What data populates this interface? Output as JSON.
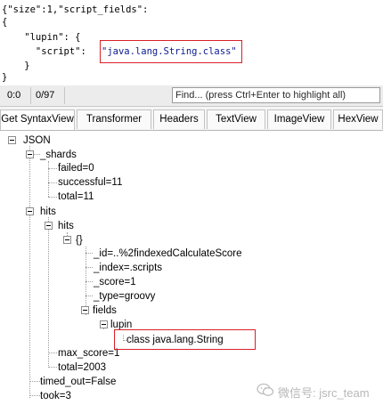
{
  "editor": {
    "lines": [
      "{\"size\":1,\"script_fields\":",
      "{",
      "    \"lupin\": {",
      "      \"script\": ",
      "    }",
      "}"
    ],
    "script_value": "\"java.lang.String.class\""
  },
  "status": {
    "position": "0:0",
    "count": "0/97",
    "find_placeholder": "Find... (press Ctrl+Enter to highlight all)"
  },
  "tabs": [
    {
      "label": "Get SyntaxView",
      "active": true
    },
    {
      "label": "Transformer",
      "active": false
    },
    {
      "label": "Headers",
      "active": false
    },
    {
      "label": "TextView",
      "active": false
    },
    {
      "label": "ImageView",
      "active": false
    },
    {
      "label": "HexView",
      "active": false
    }
  ],
  "tree": {
    "root": "JSON",
    "shards": "_shards",
    "failed": "failed=0",
    "successful": "successful=11",
    "total_shards": "total=11",
    "hits": "hits",
    "hits_inner": "hits",
    "braces": "{}",
    "id": "_id=..%2findexedCalculateScore",
    "index": "_index=.scripts",
    "score": "_score=1",
    "type": "_type=groovy",
    "fields": "fields",
    "lupin": "lupin",
    "class_value": "class java.lang.String",
    "max_score": "max_score=1",
    "total_hits": "total=2003",
    "timed_out": "timed_out=False",
    "took": "took=3"
  },
  "watermark": {
    "text": "微信号: jsrc_team",
    "icon": "wechat-icon"
  },
  "colors": {
    "highlight_border": "#d9202a",
    "string_color": "#0a1a8c",
    "tree_lines": "#9c9c9c"
  }
}
